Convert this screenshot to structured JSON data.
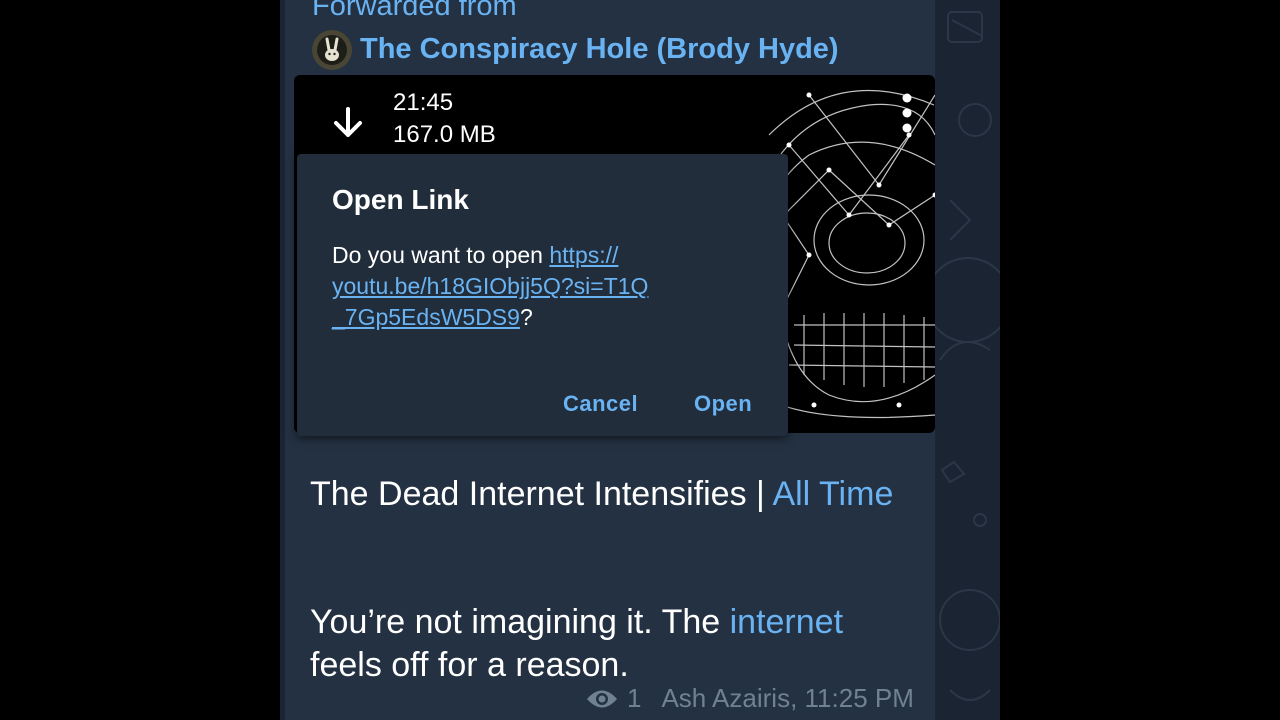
{
  "forward": {
    "label": "Forwarded from",
    "source": "The Conspiracy Hole (Brody Hyde)"
  },
  "media": {
    "duration": "21:45",
    "size": "167.0 MB",
    "download_icon": "download-arrow-icon",
    "menu_icon": "more-vertical-icon"
  },
  "dialog": {
    "title": "Open Link",
    "prompt": "Do you want to open ",
    "url_line1": "https://",
    "url_line2": "youtu.be/h18GIObjj5Q?si=T1Q",
    "url_line3": "_7Gp5EdsW5DS9",
    "suffix": "?",
    "cancel_label": "Cancel",
    "open_label": "Open"
  },
  "message": {
    "title_text": "The Dead Internet Intensifies | ",
    "title_link": "All Time",
    "body_pre": "You’re not imagining it. The ",
    "body_link": "internet",
    "body_post": " feels off for a reason."
  },
  "meta": {
    "views": "1",
    "author_time": "Ash Azairis, 11:25 PM"
  },
  "colors": {
    "accent": "#6ab3f3",
    "bubble": "#243142",
    "dialog": "#212d3b",
    "background": "#1a2432"
  }
}
